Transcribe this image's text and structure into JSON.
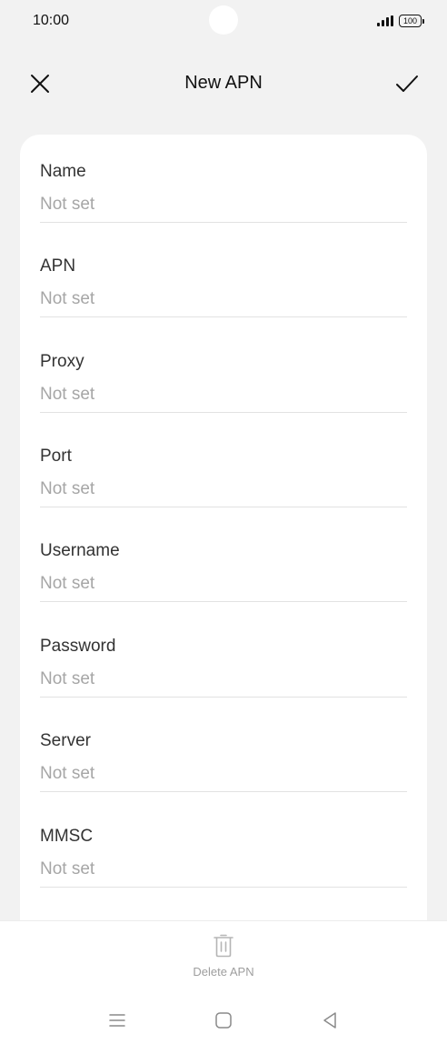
{
  "status_bar": {
    "time": "10:00",
    "battery": "100"
  },
  "header": {
    "title": "New APN",
    "close_icon": "close-icon",
    "confirm_icon": "checkmark-icon"
  },
  "fields": [
    {
      "label": "Name",
      "value": "Not set"
    },
    {
      "label": "APN",
      "value": "Not set"
    },
    {
      "label": "Proxy",
      "value": "Not set"
    },
    {
      "label": "Port",
      "value": "Not set"
    },
    {
      "label": "Username",
      "value": "Not set"
    },
    {
      "label": "Password",
      "value": "Not set"
    },
    {
      "label": "Server",
      "value": "Not set"
    },
    {
      "label": "MMSC",
      "value": "Not set"
    }
  ],
  "bottom_action": {
    "delete_label": "Delete APN",
    "icon": "trash-icon"
  },
  "nav_bar": {
    "menu_icon": "menu-icon",
    "home_icon": "home-icon",
    "back_icon": "back-icon"
  },
  "colors": {
    "background": "#f2f2f2",
    "card": "#ffffff",
    "placeholder": "#a6a6a6",
    "label": "#333333"
  }
}
